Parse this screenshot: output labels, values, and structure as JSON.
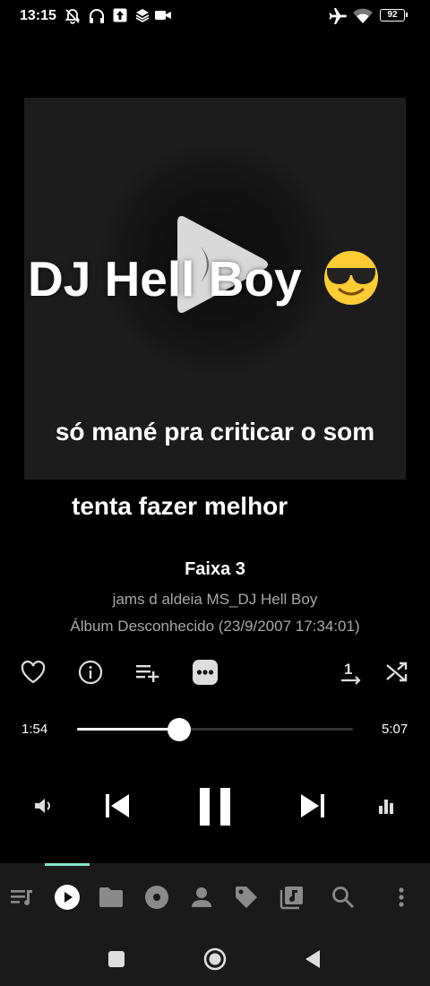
{
  "status_bar": {
    "time": "13:15",
    "battery": "92",
    "icons": [
      "mute-vibrate-icon",
      "headphones-icon",
      "upload-icon",
      "layers-icon",
      "video-camera-icon",
      "airplane-icon",
      "wifi-icon",
      "battery-icon"
    ]
  },
  "artwork": {
    "title": "DJ Hell Boy",
    "emoji": "😎",
    "caption_line1": "só mané pra criticar o som",
    "caption_line2": "tenta fazer melhor"
  },
  "track": {
    "title": "Faixa 3",
    "artist": "jams d aldeia MS_DJ Hell Boy",
    "album": "Álbum Desconhecido (23/9/2007 17:34:01)"
  },
  "actions": [
    "favorite-icon",
    "info-icon",
    "add-to-playlist-icon",
    "more-options-icon",
    "repeat-one-icon",
    "shuffle-icon"
  ],
  "player": {
    "current_time": "1:54",
    "total_time": "5:07",
    "progress": 0.371
  },
  "controls": [
    "volume-icon",
    "previous-icon",
    "pause-icon",
    "next-icon",
    "equalizer-icon"
  ],
  "bottom_nav": {
    "items": [
      "queue-icon",
      "now-playing-icon",
      "folder-icon",
      "album-icon",
      "artist-icon",
      "tag-icon",
      "playlist-icon",
      "search-icon",
      "menu-icon"
    ],
    "active": "now-playing-icon",
    "accent_color": "#7ee8c8"
  },
  "system_nav": [
    "recents-button",
    "home-button",
    "back-button"
  ]
}
